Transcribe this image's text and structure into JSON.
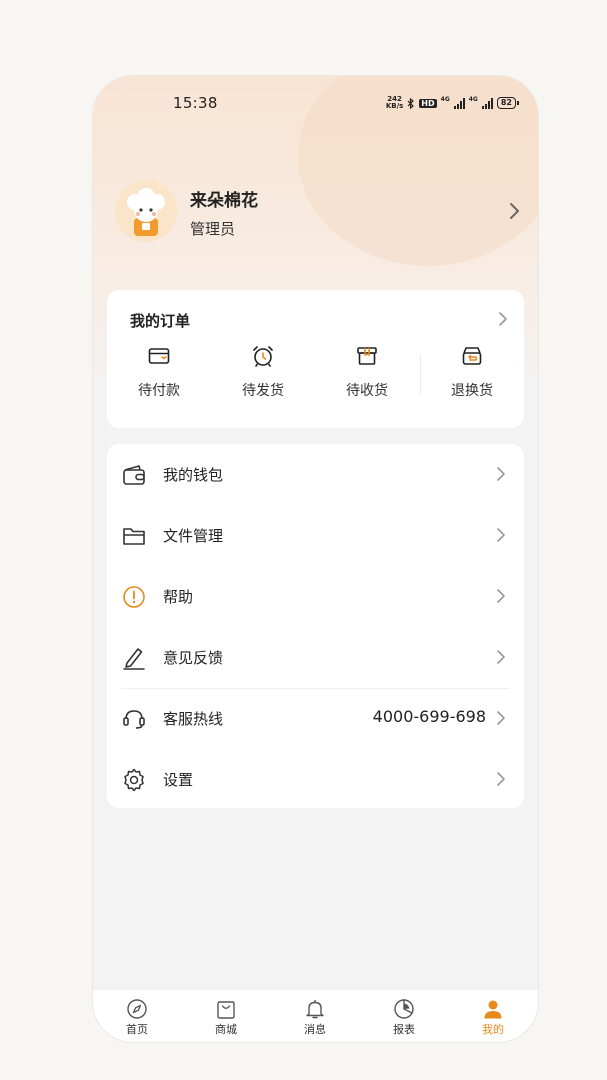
{
  "status_bar": {
    "time": "15:38",
    "network_speed_value": "242",
    "network_speed_unit": "KB/s",
    "hd_label": "HD",
    "signal_1": "4G",
    "signal_2": "4G",
    "battery": "82"
  },
  "profile": {
    "name": "来朵棉花",
    "role": "管理员"
  },
  "orders": {
    "title": "我的订单",
    "items": [
      {
        "label": "待付款",
        "icon": "wallet-card-icon"
      },
      {
        "label": "待发货",
        "icon": "alarm-clock-icon"
      },
      {
        "label": "待收货",
        "icon": "package-box-icon"
      },
      {
        "label": "退换货",
        "icon": "return-box-icon"
      }
    ]
  },
  "menu": [
    {
      "label": "我的钱包",
      "icon": "wallet-icon",
      "value": ""
    },
    {
      "label": "文件管理",
      "icon": "folder-icon",
      "value": ""
    },
    {
      "label": "帮助",
      "icon": "help-alert-icon",
      "value": ""
    },
    {
      "label": "意见反馈",
      "icon": "pencil-icon",
      "value": ""
    },
    {
      "label": "客服热线",
      "icon": "headset-icon",
      "value": "4000-699-698"
    },
    {
      "label": "设置",
      "icon": "gear-icon",
      "value": ""
    }
  ],
  "tabbar": {
    "items": [
      {
        "label": "首页",
        "icon": "compass-icon",
        "active": false
      },
      {
        "label": "商城",
        "icon": "shopping-bag-icon",
        "active": false
      },
      {
        "label": "消息",
        "icon": "bell-icon",
        "active": false
      },
      {
        "label": "报表",
        "icon": "pie-chart-icon",
        "active": false
      },
      {
        "label": "我的",
        "icon": "user-icon",
        "active": true
      }
    ]
  },
  "colors": {
    "accent": "#e8891c",
    "help_icon": "#e8891c",
    "hero_gradient_top": "#f8e4d3",
    "background": "#f4f3f4"
  }
}
